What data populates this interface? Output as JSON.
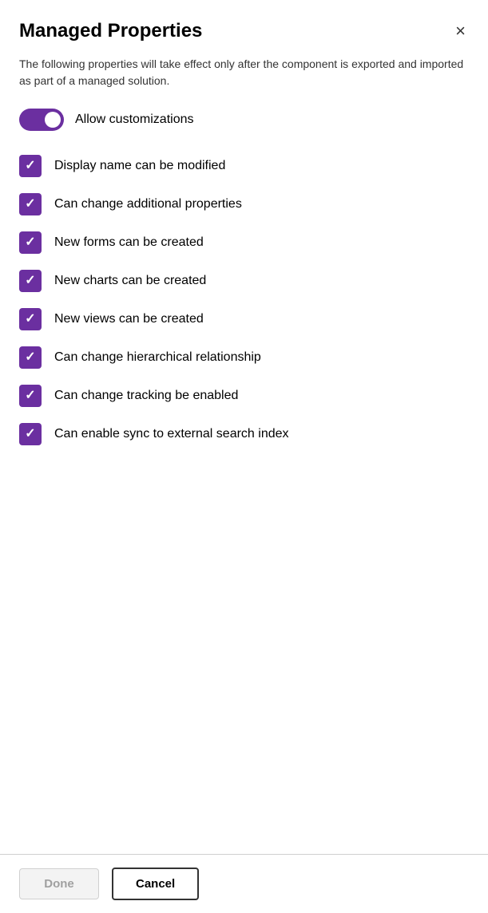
{
  "dialog": {
    "title": "Managed Properties",
    "description": "The following properties will take effect only after the component is exported and imported as part of a managed solution.",
    "close_label": "×"
  },
  "toggle": {
    "label": "Allow customizations",
    "checked": true
  },
  "checkboxes": [
    {
      "id": 1,
      "label": "Display name can be modified",
      "checked": true
    },
    {
      "id": 2,
      "label": "Can change additional properties",
      "checked": true
    },
    {
      "id": 3,
      "label": "New forms can be created",
      "checked": true
    },
    {
      "id": 4,
      "label": "New charts can be created",
      "checked": true
    },
    {
      "id": 5,
      "label": "New views can be created",
      "checked": true
    },
    {
      "id": 6,
      "label": "Can change hierarchical relationship",
      "checked": true
    },
    {
      "id": 7,
      "label": "Can change tracking be enabled",
      "checked": true
    },
    {
      "id": 8,
      "label": "Can enable sync to external search index",
      "checked": true
    }
  ],
  "footer": {
    "done_label": "Done",
    "cancel_label": "Cancel"
  }
}
